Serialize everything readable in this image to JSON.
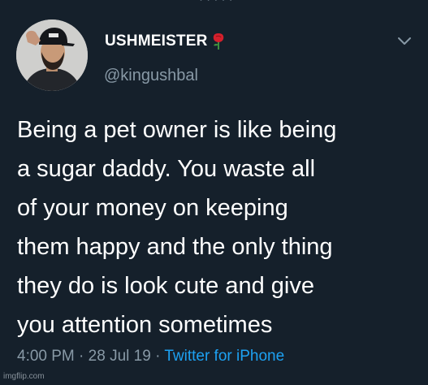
{
  "tweet": {
    "display_name": "USHMEISTER",
    "handle": "@kingushbal",
    "text_lines": [
      "Being a pet owner is like being",
      "a sugar daddy. You waste all",
      "of your money on keeping",
      "them happy and the only thing",
      "they do is look cute and give",
      "you attention sometimes"
    ],
    "time": "4:00 PM",
    "separator": "·",
    "date": "28 Jul 19",
    "source": "Twitter for iPhone"
  },
  "watermark": "imgflip.com",
  "icons": {
    "name_badge": "rose-icon",
    "menu": "chevron-down-icon"
  },
  "colors": {
    "background": "#15202b",
    "text": "#ffffff",
    "secondary": "#8899a6",
    "link": "#1da1f2",
    "rose": "#d4202c"
  }
}
